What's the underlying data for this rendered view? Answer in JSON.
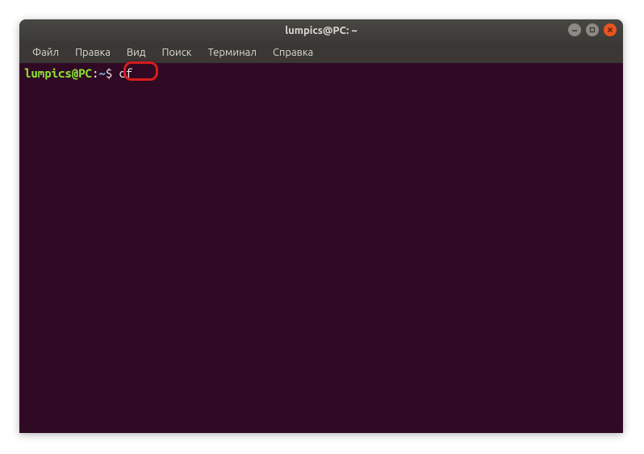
{
  "window": {
    "title": "lumpics@PC: ~"
  },
  "menubar": {
    "items": [
      {
        "label": "Файл"
      },
      {
        "label": "Правка"
      },
      {
        "label": "Вид"
      },
      {
        "label": "Поиск"
      },
      {
        "label": "Терминал"
      },
      {
        "label": "Справка"
      }
    ]
  },
  "terminal": {
    "prompt_user": "lumpics@PC",
    "prompt_colon": ":",
    "prompt_path": "~",
    "prompt_dollar": "$ ",
    "command": "df"
  },
  "annotation": {
    "highlight_target": "command df"
  }
}
